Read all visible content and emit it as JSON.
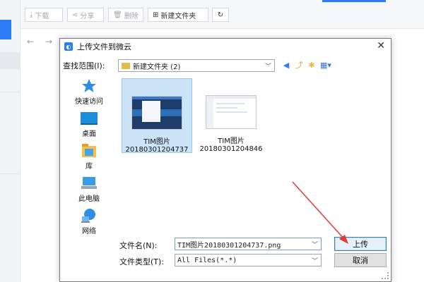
{
  "toolbar": {
    "download": "下载",
    "share": "分享",
    "delete": "删除",
    "new_folder": "新建文件夹"
  },
  "dialog": {
    "title": "上传文件到微云",
    "look_in_label": "查找范围(I):",
    "look_in_value": "新建文件夹 (2)",
    "places": [
      {
        "label": "快速访问",
        "icon": "star-icon"
      },
      {
        "label": "桌面",
        "icon": "desktop-icon"
      },
      {
        "label": "库",
        "icon": "library-icon"
      },
      {
        "label": "此电脑",
        "icon": "computer-icon"
      },
      {
        "label": "网络",
        "icon": "network-icon"
      }
    ],
    "files": [
      {
        "line1": "TIM图片",
        "line2": "20180301204737",
        "selected": true
      },
      {
        "line1": "TIM图片",
        "line2": "20180301204846",
        "selected": false
      }
    ],
    "filename_label": "文件名(N):",
    "filename_value": "TIM图片20180301204737.png",
    "filetype_label": "文件类型(T):",
    "filetype_value": "All Files(*.*)",
    "upload_button": "上传",
    "cancel_button": "取消"
  },
  "colors": {
    "accent": "#2f7df6",
    "selection": "#cce4f7",
    "annotation_arrow": "#e53935"
  }
}
